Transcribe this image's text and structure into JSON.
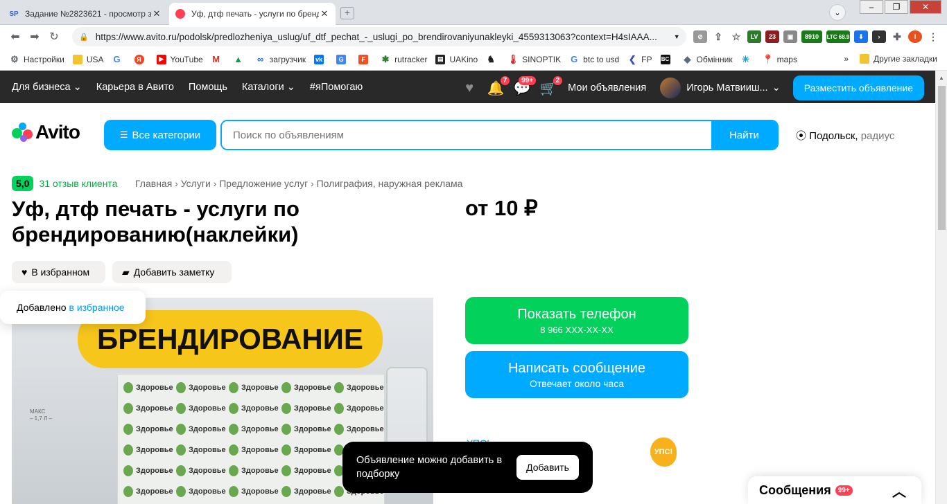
{
  "browser": {
    "tabs": [
      {
        "icon": "SP",
        "title": "Задание №2823621 - просмотр за..."
      },
      {
        "icon": "avito",
        "title": "Уф, дтф печать - услуги по бренди..."
      }
    ],
    "url": "https://www.avito.ru/podolsk/predlozheniya_uslug/uf_dtf_pechat_-_uslugi_po_brendirovaniyunakleyki_4559313063?context=H4sIAAA...",
    "extensions": [
      "LV",
      "23",
      "8910",
      "LTC 68.9"
    ],
    "bookmarks": [
      "Настройки",
      "USA",
      "YouTube",
      "загрузчик",
      "rutracker",
      "UAKino",
      "SINOPTIK",
      "btc to usd",
      "FP",
      "Обмінник",
      "maps"
    ],
    "bookmarks_more": "Другие закладки"
  },
  "avito_nav": {
    "links": [
      "Для бизнеса",
      "Карьера в Авито",
      "Помощь",
      "Каталоги",
      "#яПомогаю"
    ],
    "badges": {
      "notifications": "7",
      "messages": "99+",
      "cart": "2"
    },
    "my_ads": "Мои объявления",
    "user": "Игорь Матвииш...",
    "place_ad": "Разместить объявление"
  },
  "header": {
    "logo": "Avito",
    "categories": "Все категории",
    "search_placeholder": "Поиск по объявлениям",
    "find": "Найти",
    "location_city": "Подольск,",
    "location_radius": "радиус"
  },
  "listing": {
    "rating": "5,0",
    "reviews": "31 отзыв клиента",
    "breadcrumbs": "Главная › Услуги › Предложение услуг › Полиграфия, наружная реклама",
    "title": "Уф, дтф печать - услуги по брендированию(наклейки)",
    "price": "от 10 ₽",
    "fav_chip": "В избранном",
    "note_chip": "Добавить заметку",
    "fav_toast_text": "Добавлено",
    "fav_toast_link": "в избранное",
    "photo_banner": "БРЕНДИРОВАНИЕ",
    "sticker_label": "Здоровье",
    "phone_button": "Показать телефон",
    "phone_masked": "8 966 XXX-XX-XX",
    "msg_button": "Написать сообщение",
    "msg_sub": "Отвечает около часа",
    "ups_badge": "УПС!"
  },
  "toast_add": {
    "text": "Объявление можно добавить в подборку",
    "button": "Добавить"
  },
  "messages_widget": {
    "label": "Сообщения",
    "badge": "99+"
  }
}
